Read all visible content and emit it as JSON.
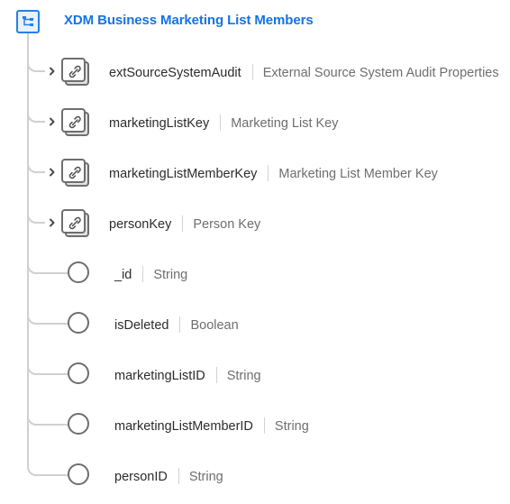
{
  "root": {
    "title": "XDM Business Marketing List Members",
    "icon": "schema-tree-icon",
    "accent_color": "#1473e6"
  },
  "fields": [
    {
      "name": "extSourceSystemAudit",
      "type": "External Source System Audit Properties",
      "kind": "object",
      "icon": "link-object-icon",
      "expandable": true
    },
    {
      "name": "marketingListKey",
      "type": "Marketing List Key",
      "kind": "object",
      "icon": "link-object-icon",
      "expandable": true
    },
    {
      "name": "marketingListMemberKey",
      "type": "Marketing List Member Key",
      "kind": "object",
      "icon": "link-object-icon",
      "expandable": true
    },
    {
      "name": "personKey",
      "type": "Person Key",
      "kind": "object",
      "icon": "link-object-icon",
      "expandable": true
    },
    {
      "name": "_id",
      "type": "String",
      "kind": "primitive",
      "icon": "circle-icon",
      "expandable": false
    },
    {
      "name": "isDeleted",
      "type": "Boolean",
      "kind": "primitive",
      "icon": "circle-icon",
      "expandable": false
    },
    {
      "name": "marketingListID",
      "type": "String",
      "kind": "primitive",
      "icon": "circle-icon",
      "expandable": false
    },
    {
      "name": "marketingListMemberID",
      "type": "String",
      "kind": "primitive",
      "icon": "circle-icon",
      "expandable": false
    },
    {
      "name": "personID",
      "type": "String",
      "kind": "primitive",
      "icon": "circle-icon",
      "expandable": false
    }
  ]
}
